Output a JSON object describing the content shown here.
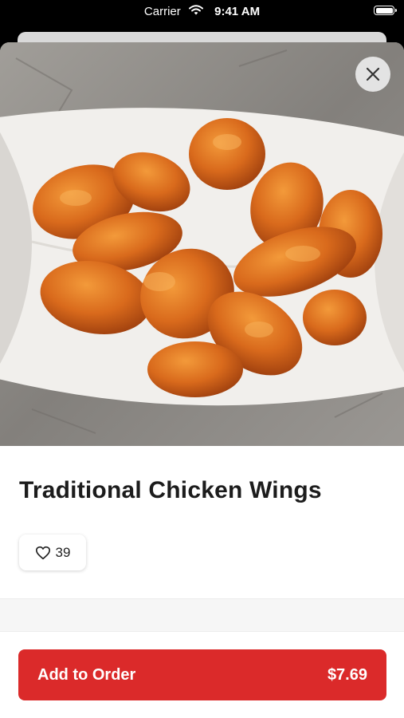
{
  "status_bar": {
    "carrier": "Carrier",
    "time": "9:41 AM"
  },
  "close_icon": "close-icon",
  "item": {
    "title": "Traditional Chicken Wings"
  },
  "like": {
    "icon": "heart-icon",
    "count": "39"
  },
  "order_button": {
    "label": "Add to Order",
    "price": "$7.69"
  },
  "colors": {
    "accent": "#db2a2a"
  }
}
